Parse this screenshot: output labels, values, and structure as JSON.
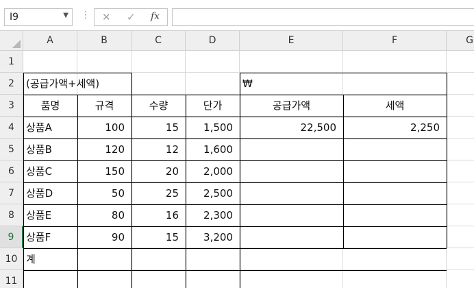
{
  "formula_bar": {
    "name_box": "I9",
    "name_box_dropdown_icon": "chevron-down-icon",
    "separator": "⋮",
    "cancel_icon": "✕",
    "enter_icon": "✓",
    "fx_label": "fx",
    "formula": ""
  },
  "columns": [
    "A",
    "B",
    "C",
    "D",
    "E",
    "F",
    "G"
  ],
  "rows": [
    "1",
    "2",
    "3",
    "4",
    "5",
    "6",
    "7",
    "8",
    "9",
    "10",
    "11"
  ],
  "selected_row": "9",
  "cells": {
    "A2": "(공급가액+세액)",
    "E2": "₩",
    "A3": "품명",
    "B3": "규격",
    "C3": "수량",
    "D3": "단가",
    "E3": "공급가액",
    "F3": "세액",
    "A4": "상품A",
    "B4": "100",
    "C4": "15",
    "D4": "1,500",
    "E4": "22,500",
    "F4": "2,250",
    "A5": "상품B",
    "B5": "120",
    "C5": "12",
    "D5": "1,600",
    "A6": "상품C",
    "B6": "150",
    "C6": "20",
    "D6": "2,000",
    "A7": "상품D",
    "B7": "50",
    "C7": "25",
    "D7": "2,500",
    "A8": "상품E",
    "B8": "80",
    "C8": "16",
    "D8": "2,300",
    "A9": "상품F",
    "B9": "90",
    "C9": "15",
    "D9": "3,200",
    "A10": "계"
  },
  "colors": {
    "selection_accent": "#1e7145",
    "header_bg": "#efefef",
    "gridline": "#dadada"
  }
}
